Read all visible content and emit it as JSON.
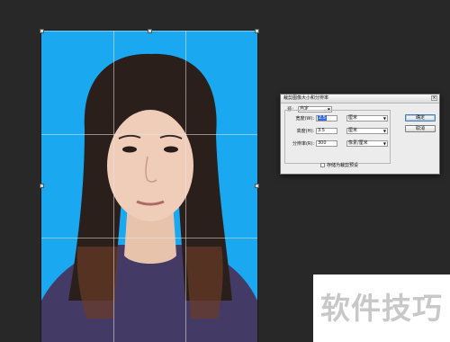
{
  "dialog": {
    "title": "裁剪图像大小和分辨率",
    "close": "×",
    "source_label": "源：",
    "source_value": "自定",
    "width_label": "宽度(W):",
    "width_value": "2.5",
    "height_label": "高度(H):",
    "height_value": "3.5",
    "resolution_label": "分辨率(R):",
    "resolution_value": "300",
    "width_unit": "厘米",
    "height_unit": "厘米",
    "resolution_unit": "像素/厘米",
    "save_preset_label": "存储为裁剪预设",
    "ok": "确定",
    "cancel": "取消"
  },
  "watermark": "软件技巧",
  "colors": {
    "app_background": "#282828",
    "photo_background": "#1aa8f0",
    "dialog_background": "#ececec",
    "selection": "#3a6ad8"
  }
}
